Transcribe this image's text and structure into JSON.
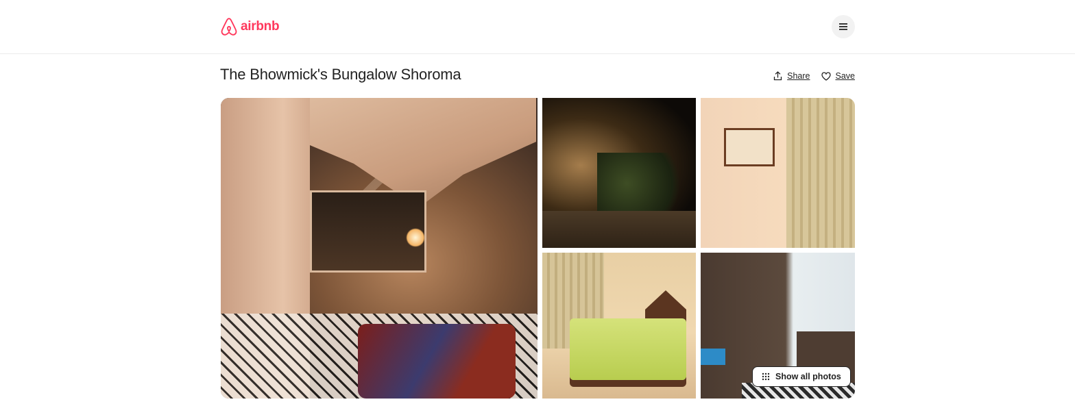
{
  "brand": {
    "name": "airbnb",
    "color": "#ff385c"
  },
  "header": {
    "menu_icon": "hamburger-icon"
  },
  "listing": {
    "title": "The Bhowmick's Bungalow Shoroma",
    "share_label": "Share",
    "save_label": "Save"
  },
  "gallery": {
    "photos": [
      "veranda-lounge",
      "night-patio",
      "bedroom-wall-frames",
      "bedroom-bed",
      "wardrobe-room"
    ],
    "show_all_label": "Show all photos"
  }
}
